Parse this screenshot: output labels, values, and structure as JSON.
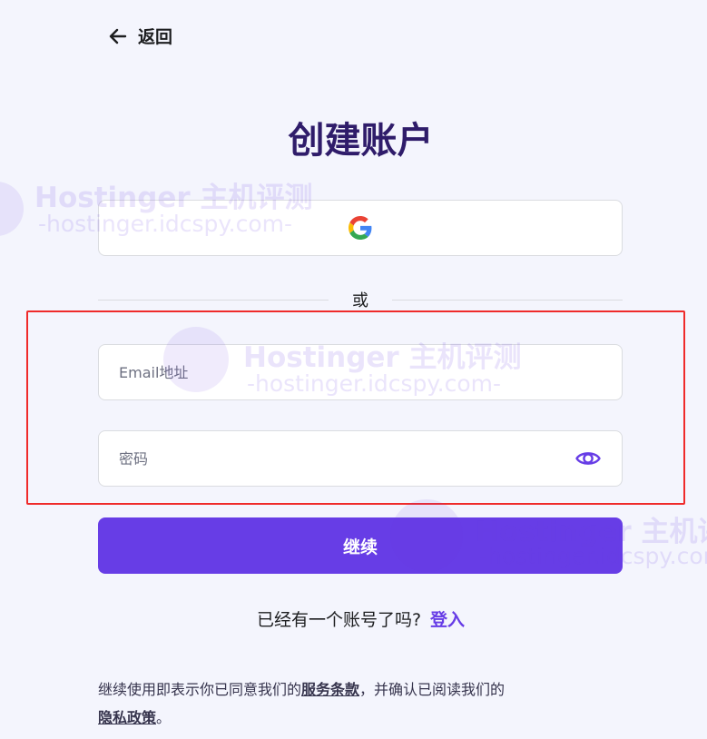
{
  "nav": {
    "back_label": "返回"
  },
  "page": {
    "title": "创建账户"
  },
  "divider": {
    "text": "或"
  },
  "form": {
    "email_placeholder": "Email地址",
    "email_value": "",
    "password_placeholder": "密码",
    "password_value": "",
    "submit_label": "继续"
  },
  "login_prompt": {
    "text": "已经有一个账号了吗?",
    "link_label": "登入"
  },
  "terms": {
    "prefix": "继续使用即表示你已同意我们的",
    "service_terms": "服务条款",
    "middle": "，并确认已阅读我们的",
    "privacy_policy": "隐私政策",
    "suffix": "。"
  },
  "watermark": {
    "title": "Hostinger 主机评测",
    "subtitle": "-hostinger.idcspy.com-"
  },
  "icons": {
    "back": "arrow-left-icon",
    "google": "google-logo-icon",
    "password_toggle": "eye-icon"
  },
  "colors": {
    "primary": "#673de6",
    "title": "#2f1c6a",
    "background": "#f4f5fd",
    "highlight": "#ef2b2b"
  }
}
